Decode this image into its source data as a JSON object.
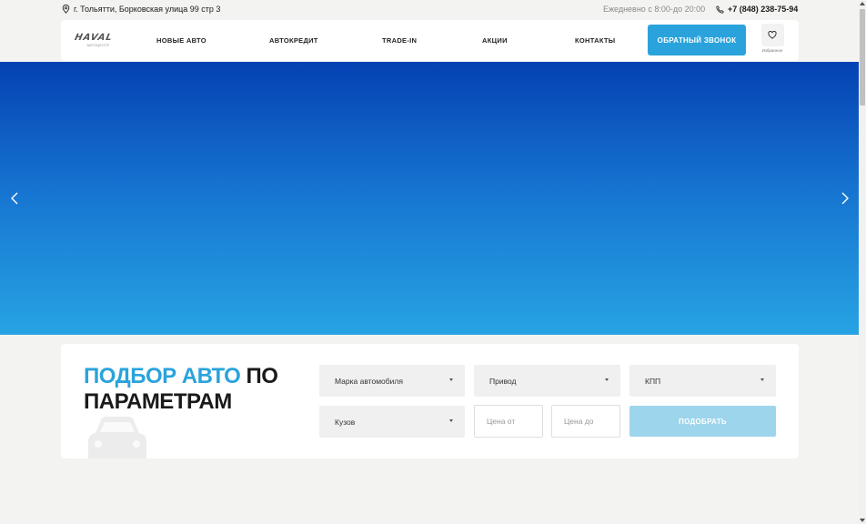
{
  "topbar": {
    "address": "г. Тольятти, Борковская улица 99 стр 3",
    "hours": "Ежедневно с 8:00-до 20:00",
    "phone": "+7 (848) 238-75-94"
  },
  "header": {
    "logo_text": "HAVAL",
    "logo_sub": "АВТОЦЕНТР",
    "nav": [
      "НОВЫЕ АВТО",
      "АВТОКРЕДИТ",
      "TRADE-IN",
      "АКЦИИ",
      "КОНТАКТЫ"
    ],
    "callback_label": "ОБРАТНЫЙ ЗВОНОК",
    "favorites_label": "Избранное"
  },
  "filter": {
    "title_accent": "ПОДБОР АВТО",
    "title_rest": "ПО ПАРАМЕТРАМ",
    "brand": "Марка автомобиля",
    "drive": "Привод",
    "gearbox": "КПП",
    "body": "Кузов",
    "price_from_placeholder": "Цена от",
    "price_to_placeholder": "Цена до",
    "submit_label": "ПОДОБРАТЬ"
  },
  "colors": {
    "accent": "#2aa3dc",
    "hero_top": "#0541b3",
    "hero_bottom": "#27a3e3",
    "submit_disabled": "#9dd5ec"
  },
  "icons": {
    "address": "location-pin-icon",
    "phone": "phone-icon",
    "favorites": "heart-icon",
    "prev": "chevron-left-icon",
    "next": "chevron-right-icon",
    "filter_decor": "car-icon"
  }
}
